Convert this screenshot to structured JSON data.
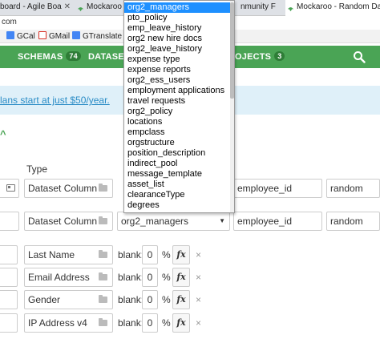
{
  "browser": {
    "tabs": [
      {
        "label": "board - Agile Boa"
      },
      {
        "label": "Mockaroo"
      },
      {
        "label": "nmunity F"
      },
      {
        "label": "Mockaroo - Random Dat"
      }
    ],
    "address": "com",
    "bookmarks": [
      {
        "label": "GCal",
        "icon": "calendar-icon",
        "color": "#4285f4"
      },
      {
        "label": "GMail",
        "icon": "gmail-icon",
        "color": "#d93025"
      },
      {
        "label": "GTranslate",
        "icon": "translate-icon",
        "color": "#4285f4"
      }
    ]
  },
  "navbar": {
    "color": "#4aa455",
    "items": [
      {
        "label": "SCHEMAS",
        "badge": "74"
      },
      {
        "label": "DATASET"
      },
      {
        "label": "OJECTS",
        "badge": "3"
      }
    ],
    "search_icon": "search-icon"
  },
  "promo": {
    "text": "lans start at just $50/year."
  },
  "caret_symbol": "^",
  "table": {
    "type_header": "Type"
  },
  "rows": [
    {
      "type": "Dataset Column",
      "dataset": "org2_managers",
      "column": "employee_id",
      "selection": "random"
    },
    {
      "type": "Dataset Column",
      "dataset": "org2_managers",
      "column": "employee_id",
      "selection": "random"
    }
  ],
  "fields": [
    {
      "type": "Last Name",
      "blank_label": "blank:",
      "blank": "0",
      "pct": "%",
      "fx": "fx",
      "remove": "×"
    },
    {
      "type": "Email Address",
      "blank_label": "blank:",
      "blank": "0",
      "pct": "%",
      "fx": "fx",
      "remove": "×"
    },
    {
      "type": "Gender",
      "blank_label": "blank:",
      "blank": "0",
      "pct": "%",
      "fx": "fx",
      "remove": "×"
    },
    {
      "type": "IP Address v4",
      "blank_label": "blank:",
      "blank": "0",
      "pct": "%",
      "fx": "fx",
      "remove": "×"
    }
  ],
  "dropdown": {
    "selected": "org2_managers",
    "options": [
      "org2_managers",
      "pto_policy",
      "emp_leave_history",
      "org2 new hire docs",
      "org2_leave_history",
      "expense type",
      "expense reports",
      "org2_ess_users",
      "employment applications",
      "travel requests",
      "org2_policy",
      "locations",
      "empclass",
      "orgstructure",
      "position_description",
      "indirect_pool",
      "message_template",
      "asset_list",
      "clearanceType",
      "degrees"
    ]
  }
}
